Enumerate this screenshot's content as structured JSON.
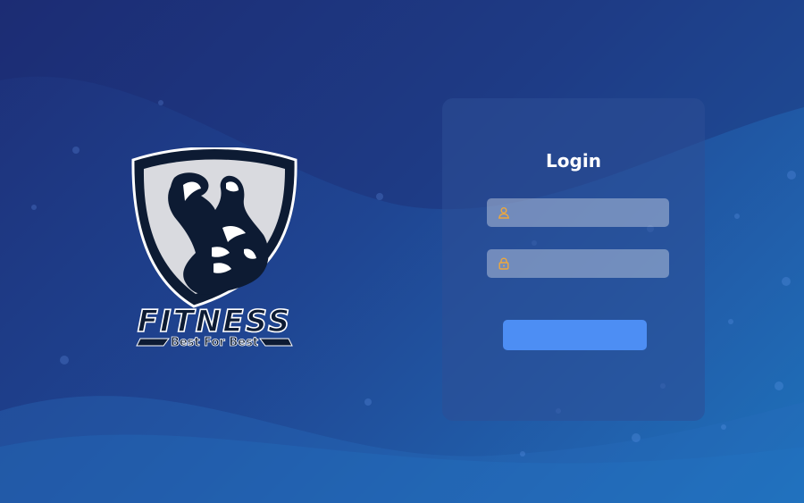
{
  "login": {
    "title": "Login",
    "username": {
      "value": "",
      "placeholder": "",
      "icon": "user-icon"
    },
    "password": {
      "value": "",
      "placeholder": "",
      "icon": "lock-icon"
    },
    "submit_label": ""
  },
  "logo": {
    "wordmark": "FITNESS",
    "tagline": "Best For Best",
    "emblem": "bodybuilder-shield"
  },
  "colors": {
    "icon_accent": "#f0a83a",
    "button": "#4d8ef4",
    "card": "#2d4e96"
  }
}
